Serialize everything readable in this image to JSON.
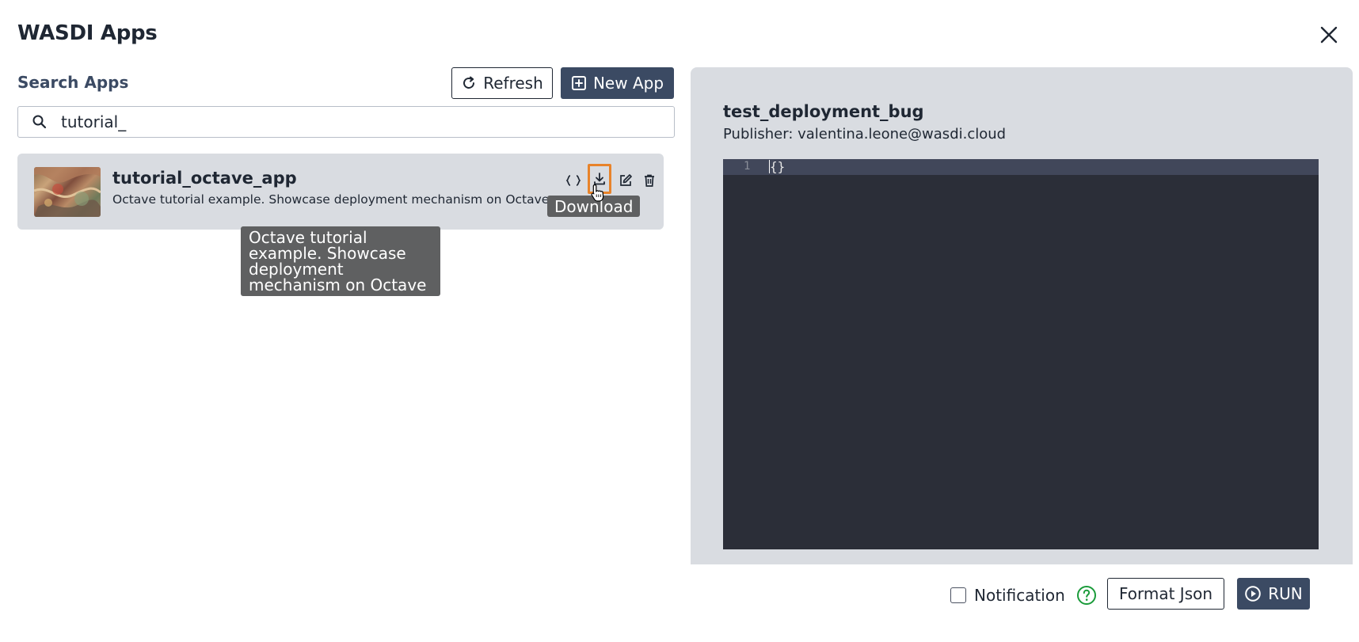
{
  "dialog": {
    "title": "WASDI Apps",
    "close_icon": "close-icon"
  },
  "search": {
    "label": "Search Apps",
    "value": "tutorial_",
    "icon": "search-icon"
  },
  "toolbar": {
    "refresh_label": "Refresh",
    "refresh_icon": "refresh-icon",
    "new_app_label": "New App",
    "new_app_icon": "plus-square-icon"
  },
  "apps": [
    {
      "name": "tutorial_octave_app",
      "description": "Octave tutorial example. Showcase deployment mechanism on Octave",
      "actions": [
        "json-braces-icon",
        "download-icon",
        "edit-icon",
        "trash-icon"
      ]
    }
  ],
  "tooltips": {
    "download": "Download",
    "description": "Octave tutorial example. Showcase deployment mechanism on Octave"
  },
  "selected_app": {
    "name": "test_deployment_bug",
    "publisher": "Publisher: valentina.leone@wasdi.cloud"
  },
  "editor": {
    "line_number": "1",
    "code": "{}"
  },
  "footer": {
    "notification_label": "Notification",
    "notification_checked": false,
    "help_icon": "question-circle-icon",
    "format_json_label": "Format Json",
    "run_label": "RUN",
    "run_icon": "play-circle-icon"
  },
  "colors": {
    "primary": "#3b4a63",
    "panel": "#d9dce1",
    "editor_bg": "#2b2e38",
    "highlight": "#e8832a",
    "help": "#1a9b3a",
    "tooltip": "#5f6061"
  }
}
